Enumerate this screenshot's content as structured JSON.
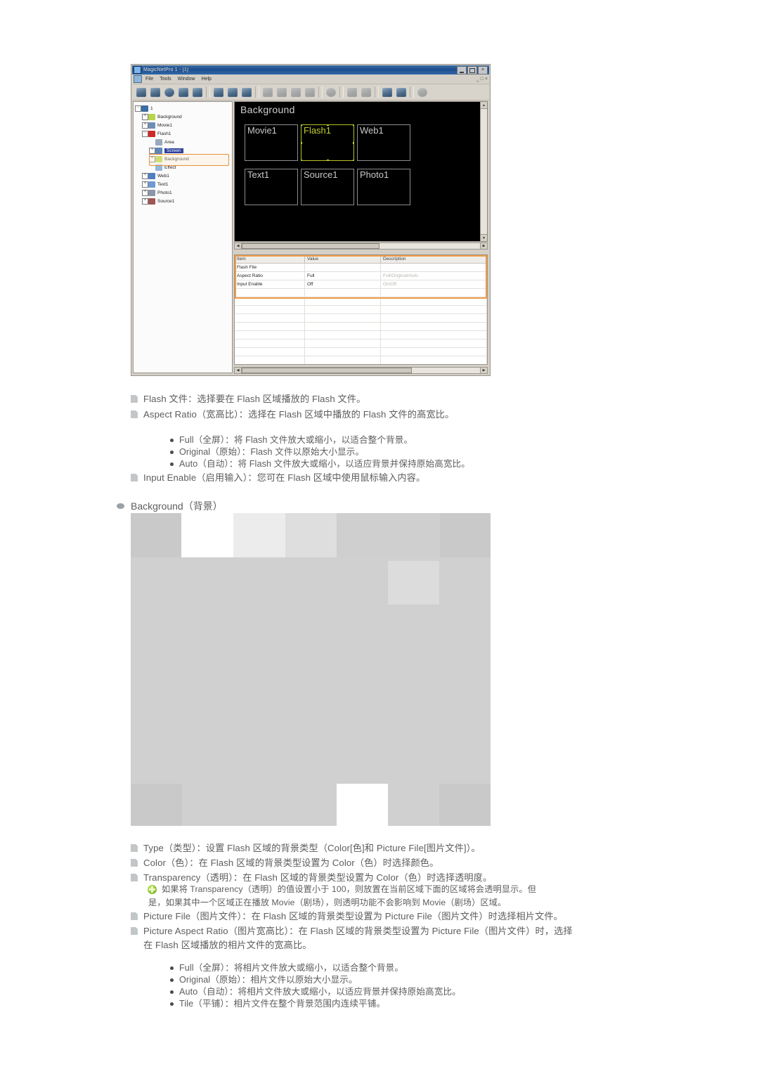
{
  "app_window": {
    "title": "MagicNetPro 1 - [1]",
    "menu": [
      "File",
      "Tools",
      "Window",
      "Help"
    ],
    "window_buttons": [
      "minimize",
      "maximize",
      "close"
    ],
    "mdi_buttons": [
      "minimize",
      "restore",
      "close"
    ],
    "tree": [
      {
        "label": "1",
        "depth": 0,
        "icon": "root-icon",
        "expander": "-",
        "selected": false
      },
      {
        "label": "Background",
        "depth": 1,
        "icon": "background-icon",
        "expander": "+",
        "selected": false
      },
      {
        "label": "Movie1",
        "depth": 1,
        "icon": "movie-icon",
        "expander": "+",
        "selected": false
      },
      {
        "label": "Flash1",
        "depth": 1,
        "icon": "flash-icon",
        "expander": "-",
        "selected": false
      },
      {
        "label": "Area",
        "depth": 2,
        "icon": "area-icon",
        "expander": "",
        "selected": false
      },
      {
        "label": "Screen",
        "depth": 2,
        "icon": "screen-icon",
        "expander": "+",
        "selected": true
      },
      {
        "label": "Background",
        "depth": 2,
        "icon": "background-icon",
        "expander": "+",
        "selected": false
      },
      {
        "label": "Effect",
        "depth": 2,
        "icon": "effect-icon",
        "expander": "",
        "selected": false
      },
      {
        "label": "Web1",
        "depth": 1,
        "icon": "web-icon",
        "expander": "+",
        "selected": false
      },
      {
        "label": "Text1",
        "depth": 1,
        "icon": "text-icon",
        "expander": "+",
        "selected": false
      },
      {
        "label": "Photo1",
        "depth": 1,
        "icon": "photo-icon",
        "expander": "+",
        "selected": false
      },
      {
        "label": "Source1",
        "depth": 1,
        "icon": "source-icon",
        "expander": "+",
        "selected": false
      }
    ],
    "canvas": {
      "title": "Background",
      "regions": [
        {
          "label": "Movie1",
          "selected": false
        },
        {
          "label": "Flash1",
          "selected": true
        },
        {
          "label": "Web1",
          "selected": false
        },
        {
          "label": "Text1",
          "selected": false
        },
        {
          "label": "Source1",
          "selected": false
        },
        {
          "label": "Photo1",
          "selected": false
        }
      ]
    },
    "property_grid": {
      "headers": [
        "Item",
        "Value",
        "Description"
      ],
      "rows": [
        {
          "item": "Flash File",
          "value": "",
          "description": ""
        },
        {
          "item": "Aspect Ratio",
          "value": "Full",
          "description": "Full/Original/Auto"
        },
        {
          "item": "Input Enable",
          "value": "Off",
          "description": "On/Off"
        },
        {
          "item": "",
          "value": "",
          "description": ""
        },
        {
          "item": "",
          "value": "",
          "description": ""
        },
        {
          "item": "",
          "value": "",
          "description": ""
        },
        {
          "item": "",
          "value": "",
          "description": ""
        },
        {
          "item": "",
          "value": "",
          "description": ""
        },
        {
          "item": "",
          "value": "",
          "description": ""
        },
        {
          "item": "",
          "value": "",
          "description": ""
        },
        {
          "item": "",
          "value": "",
          "description": ""
        },
        {
          "item": "",
          "value": "",
          "description": ""
        },
        {
          "item": "",
          "value": "",
          "description": ""
        }
      ]
    },
    "accent_highlight_color": "#ef9c45",
    "selection_color": "#2a3f9e"
  },
  "doc": {
    "flash_items": [
      "Flash 文件：选择要在 Flash 区域播放的 Flash 文件。",
      "Aspect Ratio（宽高比）：选择在 Flash 区域中播放的 Flash 文件的高宽比。"
    ],
    "flash_sub_items": [
      "Full（全屏）：将 Flash 文件放大或缩小，以适合整个背景。",
      "Original（原始）：Flash 文件以原始大小显示。",
      "Auto（自动）：将 Flash 文件放大或缩小，以适应背景并保持原始高宽比。"
    ],
    "input_enable_item": "Input Enable（启用输入）：您可在 Flash 区域中使用鼠标输入内容。",
    "background_heading": "Background（背景）",
    "background_items": [
      "Type（类型）：设置 Flash 区域的背景类型（Color[色]和 Picture File[图片文件]）。",
      "Color（色）：在 Flash 区域的背景类型设置为 Color（色）时选择颜色。",
      "Transparency（透明）：在 Flash 区域的背景类型设置为 Color（色）时选择透明度。"
    ],
    "note_line1": "如果将 Transparency（透明）的值设置小于 100，则放置在当前区域下面的区域将会透明显示。但",
    "note_line2": "是，如果其中一个区域正在播放 Movie（剧场），则透明功能不会影响到 Movie（剧场）区域。",
    "picture_file_item": "Picture File（图片文件）：在 Flash 区域的背景类型设置为 Picture File（图片文件）时选择相片文件。",
    "picture_aspect_line1": "Picture Aspect Ratio（图片宽高比）：在 Flash 区域的背景类型设置为 Picture File（图片文件）时，选择",
    "picture_aspect_line2": "在 Flash 区域播放的相片文件的宽高比。",
    "picture_sub_items": [
      "Full（全屏）：将相片文件放大或缩小，以适合整个背景。",
      "Original（原始）：相片文件以原始大小显示。",
      "Auto（自动）：将相片文件放大或缩小，以适应背景并保持原始高宽比。",
      "Tile（平铺）：相片文件在整个背景范围内连续平铺。"
    ]
  }
}
